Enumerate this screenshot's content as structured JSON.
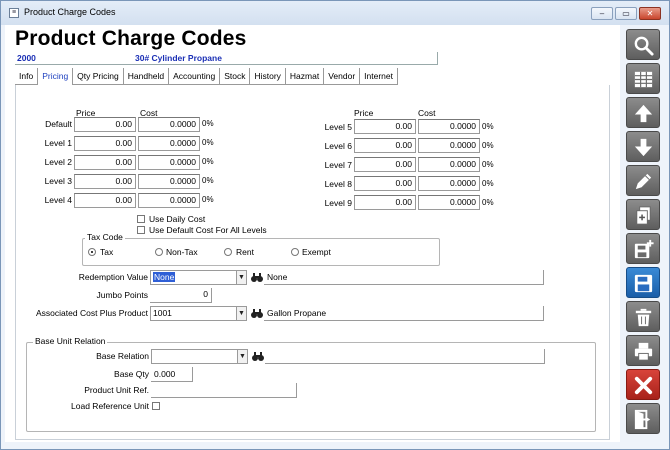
{
  "window": {
    "title": "Product Charge Codes",
    "icon": "app-icon",
    "controls": [
      "minimize-icon",
      "restore-icon",
      "close-icon"
    ]
  },
  "header": {
    "heading": "Product Charge Codes",
    "code": "2000",
    "description": "30# Cylinder Propane"
  },
  "tabs": [
    {
      "label": "Info",
      "active": false
    },
    {
      "label": "Pricing",
      "active": true
    },
    {
      "label": "Qty Pricing",
      "active": false
    },
    {
      "label": "Handheld",
      "active": false
    },
    {
      "label": "Accounting",
      "active": false
    },
    {
      "label": "Stock",
      "active": false
    },
    {
      "label": "History",
      "active": false
    },
    {
      "label": "Hazmat",
      "active": false
    },
    {
      "label": "Vendor",
      "active": false
    },
    {
      "label": "Internet",
      "active": false
    }
  ],
  "pricing": {
    "price_header": "Price",
    "cost_header": "Cost",
    "left_levels": [
      {
        "label": "Default",
        "price": "0.00",
        "cost": "0.0000",
        "pct": "0%"
      },
      {
        "label": "Level 1",
        "price": "0.00",
        "cost": "0.0000",
        "pct": "0%"
      },
      {
        "label": "Level 2",
        "price": "0.00",
        "cost": "0.0000",
        "pct": "0%"
      },
      {
        "label": "Level 3",
        "price": "0.00",
        "cost": "0.0000",
        "pct": "0%"
      },
      {
        "label": "Level 4",
        "price": "0.00",
        "cost": "0.0000",
        "pct": "0%"
      }
    ],
    "right_levels": [
      {
        "label": "Level 5",
        "price": "0.00",
        "cost": "0.0000",
        "pct": "0%"
      },
      {
        "label": "Level 6",
        "price": "0.00",
        "cost": "0.0000",
        "pct": "0%"
      },
      {
        "label": "Level 7",
        "price": "0.00",
        "cost": "0.0000",
        "pct": "0%"
      },
      {
        "label": "Level 8",
        "price": "0.00",
        "cost": "0.0000",
        "pct": "0%"
      },
      {
        "label": "Level 9",
        "price": "0.00",
        "cost": "0.0000",
        "pct": "0%"
      }
    ],
    "use_daily_cost": {
      "label": "Use Daily Cost",
      "checked": false
    },
    "use_default_cost": {
      "label": "Use Default Cost For All Levels",
      "checked": false
    }
  },
  "tax_code": {
    "title": "Tax Code",
    "options": [
      "Tax",
      "Non-Tax",
      "Rent",
      "Exempt"
    ],
    "selected": "Tax"
  },
  "redemption": {
    "label": "Redemption Value",
    "value": "None",
    "description": "None"
  },
  "jumbo": {
    "label": "Jumbo Points",
    "value": "0"
  },
  "associated": {
    "label": "Associated Cost Plus Product",
    "value": "1001",
    "description": "Gallon Propane"
  },
  "base_unit": {
    "title": "Base Unit Relation",
    "relation_label": "Base Relation",
    "relation_value": "",
    "qty_label": "Base Qty",
    "qty_value": "0.000",
    "unit_ref_label": "Product Unit Ref.",
    "unit_ref_value": "",
    "load_ref_label": "Load Reference Unit",
    "load_ref_checked": false
  },
  "toolbar": [
    "search-icon",
    "grid-icon",
    "arrow-up-icon",
    "arrow-down-icon",
    "pencil-icon",
    "copy-document-icon",
    "new-save-icon",
    "save-disk-icon",
    "trash-icon",
    "print-icon",
    "cancel-x-icon",
    "exit-door-icon"
  ]
}
